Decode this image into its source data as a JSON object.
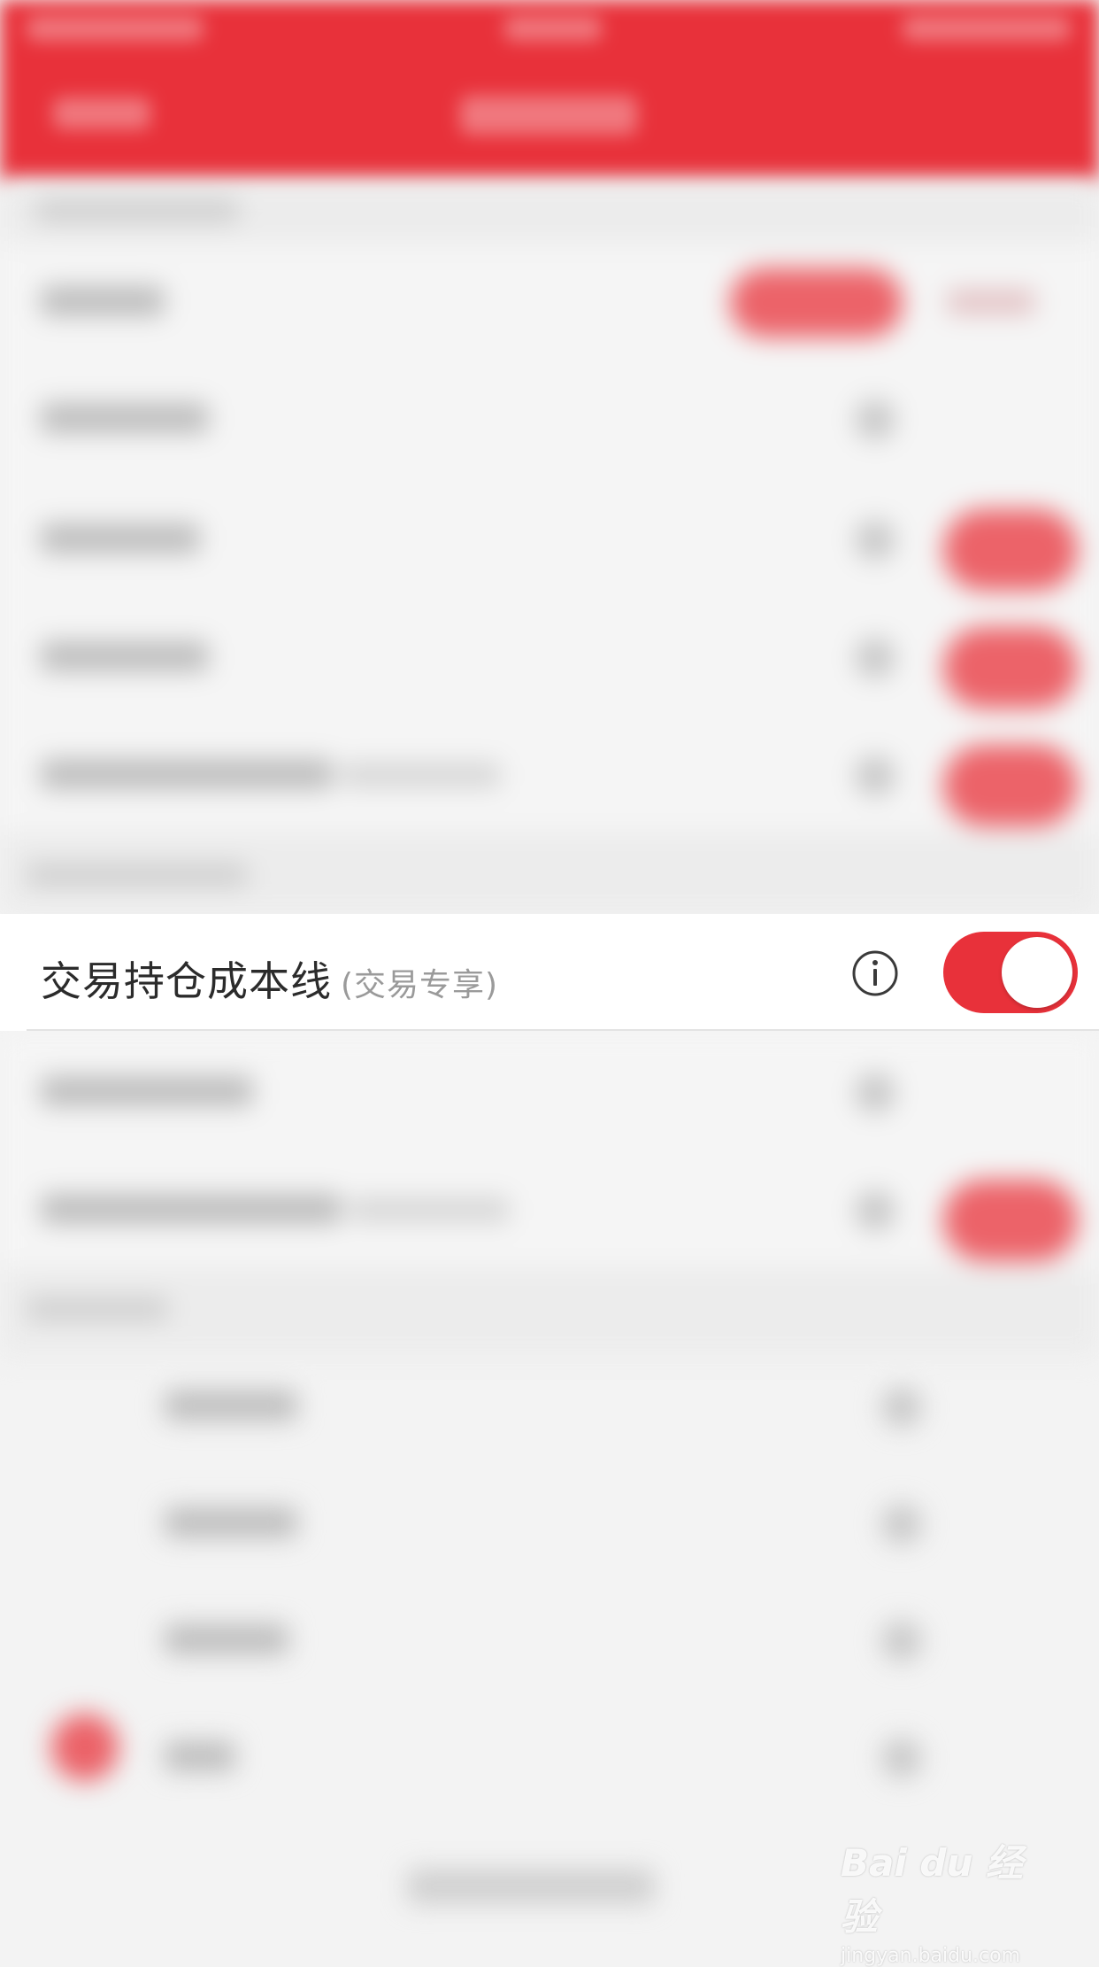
{
  "setting_row": {
    "label": "交易持仓成本线",
    "sublabel": "(交易专享)",
    "toggle_on": true
  },
  "watermark": {
    "logo": "Bai du 经验",
    "url": "jingyan.baidu.com"
  },
  "colors": {
    "accent": "#e8313a",
    "background": "#f3f3f3",
    "row_background": "#ffffff",
    "label": "#2b2b2b",
    "sublabel": "#9a9a9a"
  },
  "icons": [
    "info-icon"
  ]
}
